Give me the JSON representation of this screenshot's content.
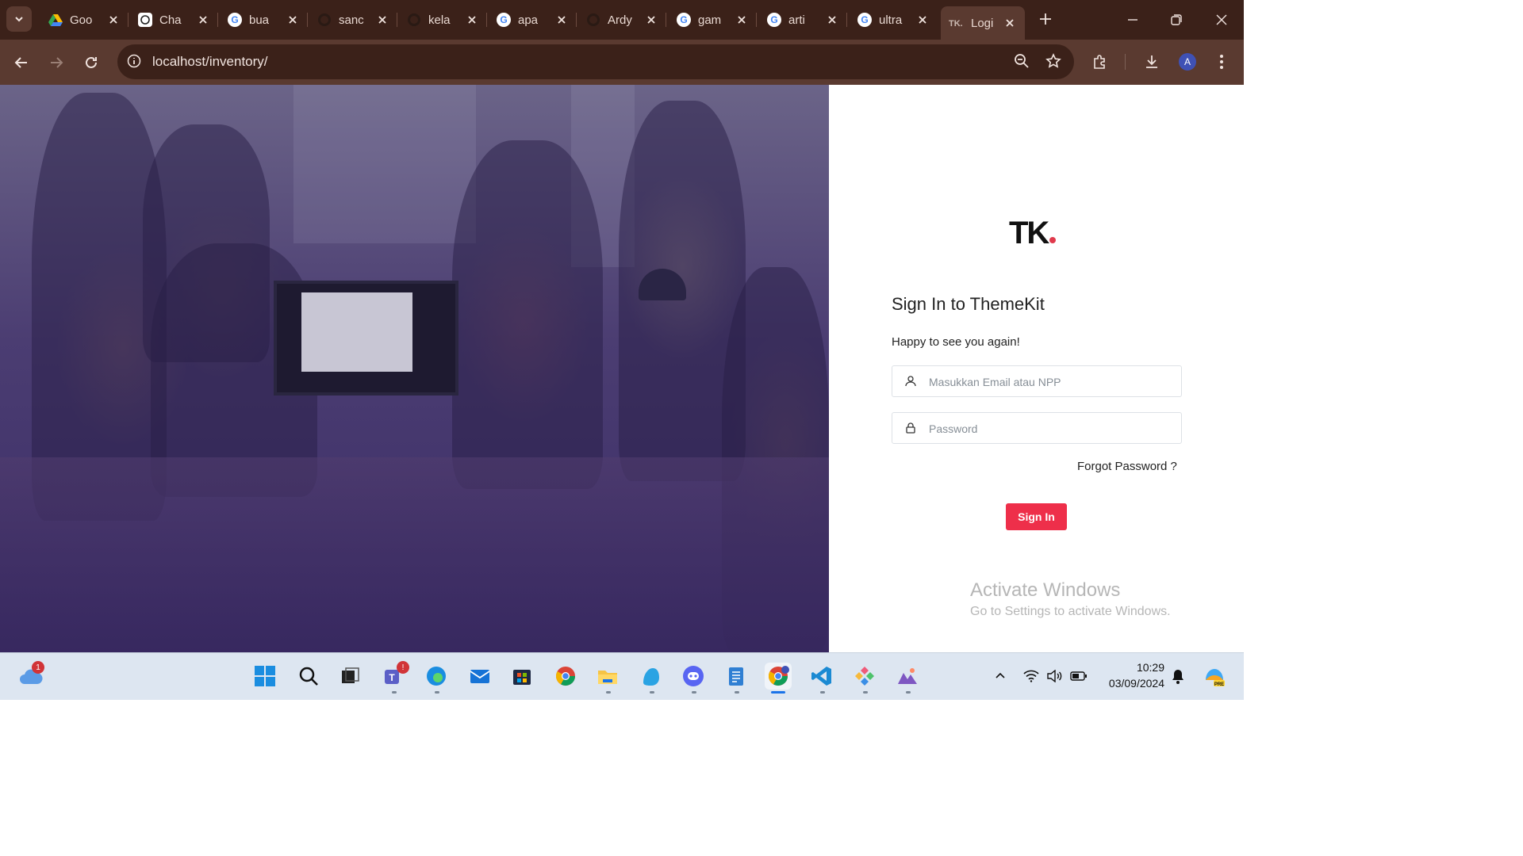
{
  "browser": {
    "tabs": [
      {
        "label": "Goo",
        "icon": "google-drive-icon"
      },
      {
        "label": "Cha",
        "icon": "chatgpt-icon"
      },
      {
        "label": "bua",
        "icon": "google-icon"
      },
      {
        "label": "sanc",
        "icon": "github-icon"
      },
      {
        "label": "kela",
        "icon": "github-icon"
      },
      {
        "label": "apa",
        "icon": "google-icon"
      },
      {
        "label": "Ardy",
        "icon": "github-icon"
      },
      {
        "label": "gam",
        "icon": "google-icon"
      },
      {
        "label": "arti",
        "icon": "google-icon"
      },
      {
        "label": "ultra",
        "icon": "google-icon"
      },
      {
        "label": "Logi",
        "icon": "themekit-icon",
        "active": true
      }
    ],
    "url": "localhost/inventory/",
    "profile_initial": "A"
  },
  "login": {
    "logo_text": "TK",
    "title": "Sign In to ThemeKit",
    "subtitle": "Happy to see you again!",
    "email_placeholder": "Masukkan Email atau NPP",
    "password_placeholder": "Password",
    "forgot_label": "Forgot Password ?",
    "signin_label": "Sign In",
    "accent_color": "#ee2f4a"
  },
  "watermark": {
    "line1": "Activate Windows",
    "line2": "Go to Settings to activate Windows."
  },
  "taskbar": {
    "weather_badge": "1",
    "teams_badge": "!",
    "apps": [
      "start-icon",
      "search-icon",
      "task-view-icon",
      "teams-icon",
      "edge-icon",
      "mail-icon",
      "store-icon",
      "chrome-icon",
      "file-explorer-icon",
      "gimp-icon",
      "discord-icon",
      "notepad-icon",
      "chrome-profile-icon",
      "vscode-icon",
      "app-icon",
      "paint-icon"
    ],
    "time": "10:29",
    "date": "03/09/2024"
  }
}
